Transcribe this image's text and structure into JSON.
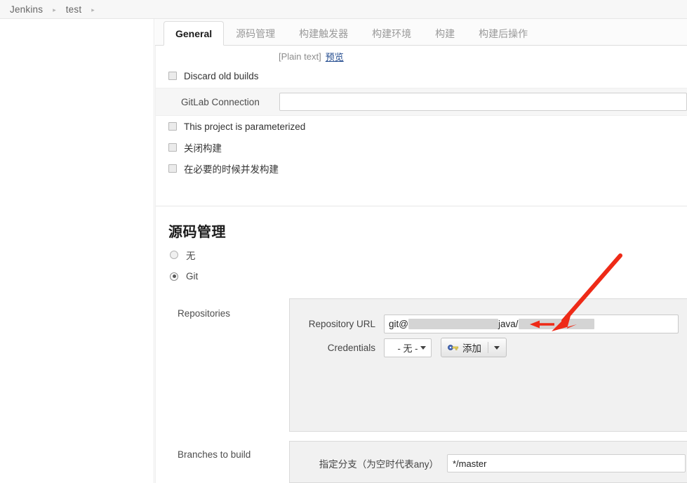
{
  "breadcrumb": {
    "items": [
      {
        "label": "Jenkins"
      },
      {
        "label": "test"
      }
    ],
    "separator": "▸"
  },
  "tabs": [
    {
      "label": "General",
      "active": true
    },
    {
      "label": "源码管理",
      "active": false
    },
    {
      "label": "构建触发器",
      "active": false
    },
    {
      "label": "构建环境",
      "active": false
    },
    {
      "label": "构建",
      "active": false
    },
    {
      "label": "构建后操作",
      "active": false
    }
  ],
  "general": {
    "plain_text_label": "[Plain text]",
    "preview_link": "预览",
    "discard_old_builds": "Discard old builds",
    "gitlab_connection_label": "GitLab Connection",
    "gitlab_connection_value": "",
    "gitlab_connection_placeholder": "",
    "project_parameterized": "This project is parameterized",
    "disable_build": "关闭构建",
    "concurrent_build": "在必要的时候并发构建"
  },
  "scm": {
    "heading": "源码管理",
    "options": [
      {
        "label": "无",
        "selected": false
      },
      {
        "label": "Git",
        "selected": true
      }
    ],
    "repositories_label": "Repositories",
    "repository_url_label": "Repository URL",
    "repository_url_prefix": "git@",
    "repository_url_middle": "java/",
    "credentials_label": "Credentials",
    "credentials_value": "- 无 -",
    "add_button_label": "添加",
    "branches_label": "Branches to build",
    "branch_spec_label": "指定分支（为空时代表any）",
    "branch_spec_value": "*/master"
  },
  "annotation": {
    "arrow_color": "#ee2a17",
    "note": "red-arrow-pointing-to-repository-url"
  },
  "colors": {
    "accent_link": "#214a8e",
    "panel_bg": "#f1f1f1",
    "page_bg": "#ffffff",
    "tab_active_bg": "#ffffff",
    "redaction": "#d4d4d4"
  }
}
